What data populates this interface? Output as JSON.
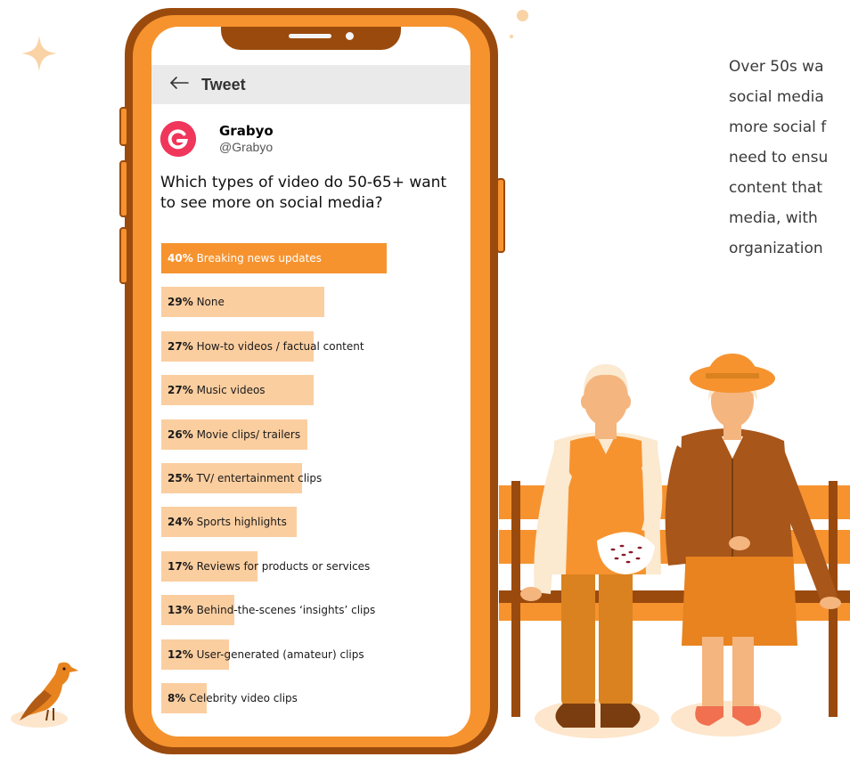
{
  "tweet_header": {
    "title": "Tweet"
  },
  "author": {
    "name": "Grabyo",
    "handle": "@Grabyo",
    "avatar_letter": "G"
  },
  "question": "Which types of video do 50-65+ want to see more on social media?",
  "poll": {
    "options": [
      {
        "percent": "40%",
        "label": "Breaking news updates",
        "value": 40
      },
      {
        "percent": "29%",
        "label": "None",
        "value": 29
      },
      {
        "percent": "27%",
        "label": "How-to videos / factual content",
        "value": 27
      },
      {
        "percent": "27%",
        "label": "Music videos",
        "value": 27
      },
      {
        "percent": "26%",
        "label": "Movie clips/ trailers",
        "value": 26
      },
      {
        "percent": "25%",
        "label": "TV/ entertainment clips",
        "value": 25
      },
      {
        "percent": "24%",
        "label": "Sports highlights",
        "value": 24
      },
      {
        "percent": "17%",
        "label": "Reviews for products or services",
        "value": 17
      },
      {
        "percent": "13%",
        "label": "Behind-the-scenes  ‘insights’ clips",
        "value": 13
      },
      {
        "percent": "12%",
        "label": "User-generated (amateur) clips",
        "value": 12
      },
      {
        "percent": "8%",
        "label": "Celebrity video clips",
        "value": 8
      }
    ],
    "colors": {
      "top": "#f6932f",
      "rest": "#fbcea0"
    }
  },
  "paragraph": {
    "lines": [
      "Over 50s wa",
      "social media",
      "more social f",
      "need to ensu",
      "content that",
      "media, with",
      "organization"
    ]
  },
  "colors": {
    "phone_frame": "#9a4a0d",
    "phone_body": "#f6932f",
    "avatar": "#f0365b",
    "header_bar": "#eaeaea"
  },
  "icons": {
    "back": "left-arrow-icon",
    "wifi": "wifi-icon",
    "battery": "battery-icon",
    "sparkle": "sparkle-icon",
    "bird": "bird-icon"
  }
}
